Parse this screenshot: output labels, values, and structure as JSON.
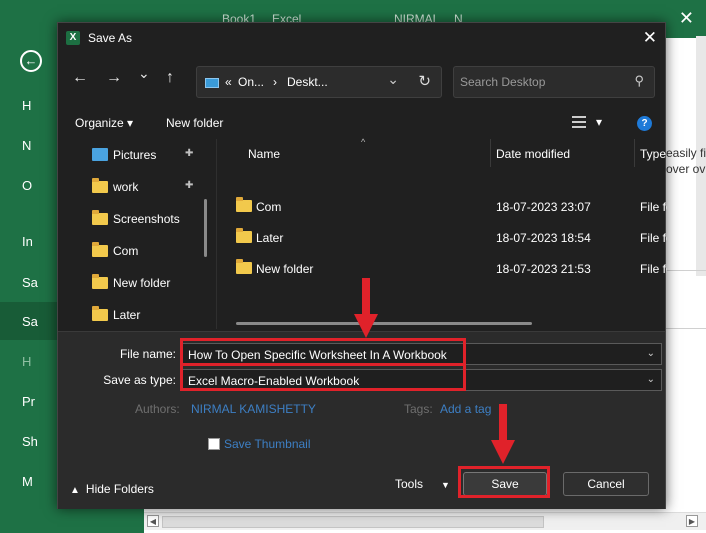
{
  "excel_bg": {
    "title_book": "Book1",
    "title_app": "Excel",
    "user": "NIRMAL",
    "user_initial": "N",
    "sidebar_letters": [
      "H",
      "N",
      "O",
      "In",
      "Sa",
      "Sa",
      "H",
      "Pr",
      "Sh",
      "M"
    ],
    "right_text_1": "easily fi",
    "right_text_2": "over ov"
  },
  "dialog": {
    "title": "Save As",
    "app_icon_letter": "X",
    "close_glyph": "✕",
    "nav": {
      "back_glyph": "←",
      "forward_glyph": "→",
      "recent_glyph": "⌄",
      "up_glyph": "↑",
      "address_prefix": "«",
      "address_seg1": "On...",
      "address_sep": "›",
      "address_seg2": "Deskt...",
      "address_dropdown": "⌄",
      "refresh_glyph": "↻",
      "search_placeholder": "Search Desktop",
      "search_glyph": "⚲"
    },
    "toolbar": {
      "organize": "Organize",
      "organize_caret": "▾",
      "new_folder": "New folder",
      "view_caret": "▾",
      "help": "?"
    },
    "sidebar": [
      {
        "label": "Pictures",
        "icon": "pictures-icon",
        "pinned": true
      },
      {
        "label": "work",
        "icon": "folder-icon",
        "pinned": true
      },
      {
        "label": "Screenshots",
        "icon": "folder-icon",
        "pinned": false
      },
      {
        "label": "Com",
        "icon": "folder-icon",
        "pinned": false
      },
      {
        "label": "New folder",
        "icon": "folder-icon",
        "pinned": false
      },
      {
        "label": "Later",
        "icon": "folder-icon",
        "pinned": false
      }
    ],
    "pin_glyph": "📌",
    "columns": {
      "name": "Name",
      "date": "Date modified",
      "type": "Type"
    },
    "sort_caret": "^",
    "files": [
      {
        "name": "Com",
        "date": "18-07-2023 23:07",
        "type": "File folder"
      },
      {
        "name": "Later",
        "date": "18-07-2023 18:54",
        "type": "File folder"
      },
      {
        "name": "New folder",
        "date": "18-07-2023 21:53",
        "type": "File folder"
      }
    ],
    "form": {
      "file_name_label": "File name:",
      "file_name_value": "How To Open Specific Worksheet In A Workbook",
      "save_type_label": "Save as type:",
      "save_type_value": "Excel Macro-Enabled Workbook",
      "dropdown_glyph": "⌄",
      "authors_label": "Authors:",
      "authors_value": "NIRMAL KAMISHETTY",
      "tags_label": "Tags:",
      "tags_value": "Add a tag",
      "thumbnail_label": "Save Thumbnail"
    },
    "footer": {
      "hide_folders": "Hide Folders",
      "hide_caret": "▲",
      "tools": "Tools",
      "tools_caret": "▼",
      "save": "Save",
      "cancel": "Cancel"
    }
  },
  "colors": {
    "excel_green": "#1e7145",
    "dialog_bg": "#202020",
    "highlight_red": "#e0222a",
    "link_blue": "#3d7fc4"
  }
}
